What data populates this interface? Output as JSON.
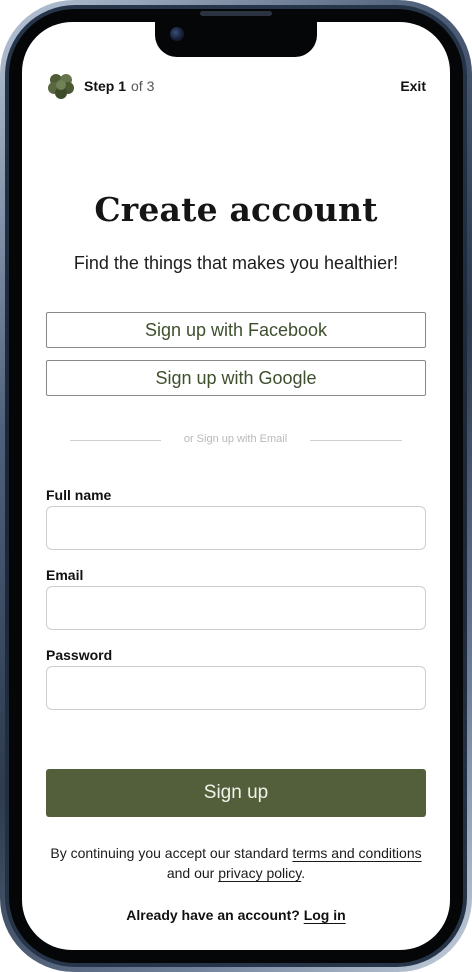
{
  "header": {
    "logo_icon": "leaf-cluster-icon",
    "step_current": "Step 1",
    "step_total": "of 3",
    "exit_label": "Exit"
  },
  "hero": {
    "title": "Create account",
    "subtitle": "Find the things that makes you healthier!"
  },
  "social": {
    "facebook_label": "Sign up with Facebook",
    "google_label": "Sign up with Google"
  },
  "divider_text": "or Sign up with Email",
  "form": {
    "full_name": {
      "label": "Full name",
      "value": ""
    },
    "email": {
      "label": "Email",
      "value": ""
    },
    "password": {
      "label": "Password",
      "value": ""
    }
  },
  "signup_label": "Sign up",
  "terms": {
    "prefix": "By continuing you accept our standard ",
    "terms_link": "terms and conditions",
    "middle": "and our ",
    "privacy_link": "privacy policy",
    "suffix": "."
  },
  "login": {
    "prompt": "Already have an account? ",
    "link": "Log in"
  },
  "colors": {
    "primary": "#525f3a",
    "accent_text": "#3e4f2e"
  }
}
